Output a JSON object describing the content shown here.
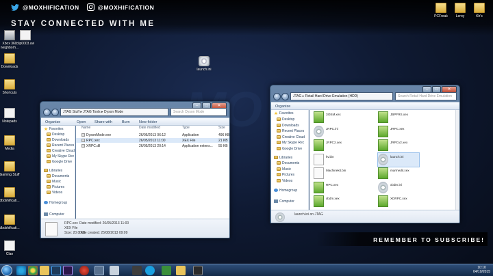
{
  "banner": {
    "twitter_handle": "@MOXHIFICATION",
    "instagram_handle": "@MOXHIFICATION",
    "stay_connected": "STAY CONNECTED WITH ME",
    "remember": "REMEMBER TO SUBSCRIBE!"
  },
  "desktop_icons_left": [
    {
      "label": "Xbox 360 neighborh...",
      "kind": "exe"
    },
    {
      "label": "clip0003.avi",
      "kind": "file"
    },
    {
      "label": "Downloads",
      "kind": "folder"
    },
    {
      "label": "Shortcuts",
      "kind": "folder"
    },
    {
      "label": "Notepads",
      "kind": "file"
    },
    {
      "label": "Media",
      "kind": "folder"
    },
    {
      "label": "Gaming Stuff",
      "kind": "folder"
    },
    {
      "label": "dbdshificati...",
      "kind": "folder"
    },
    {
      "label": "dbdshificati...",
      "kind": "folder"
    },
    {
      "label": "Clan",
      "kind": "file"
    }
  ],
  "desktop_icons_right": [
    {
      "label": "PCFreak",
      "kind": "folder"
    },
    {
      "label": "Leroy",
      "kind": "folder"
    },
    {
      "label": "Kh's",
      "kind": "folder"
    }
  ],
  "desktop_launch_ini": "launch.ini",
  "taskbar": {
    "time": "10:10",
    "date": "04/10/2015"
  },
  "win_left": {
    "address": [
      "JTAG Stuff",
      "JTAG Tools",
      "Dyson Mode"
    ],
    "search_placeholder": "Search Dyson Mode",
    "commands": [
      "Organize",
      "Open",
      "Share with",
      "Burn",
      "New folder"
    ],
    "favorites_header": "Favorites",
    "favorites": [
      "Desktop",
      "Downloads",
      "Recent Places",
      "Creative Cloud",
      "My Skype Rec",
      "Google Drive"
    ],
    "libraries_header": "Libraries",
    "libraries": [
      "Documents",
      "Music",
      "Pictures",
      "Videos"
    ],
    "homegroup": "Homegroup",
    "computer": "Computer",
    "columns": [
      "Name",
      "Date modified",
      "Type",
      "Size"
    ],
    "files": [
      {
        "name": "DysonMode.exe",
        "date": "26/05/2013 06:12",
        "type": "Application",
        "size": "496 KB"
      },
      {
        "name": "RPC.xex",
        "date": "26/05/2013 11:00",
        "type": "XEX File",
        "size": "21 KB"
      },
      {
        "name": "XRPC.dll",
        "date": "26/05/2013 20:14",
        "type": "Application extens...",
        "size": "55 KB"
      }
    ],
    "detail": {
      "name": "RPC.xex",
      "modified_label": "Date modified:",
      "modified": "26/05/2013 11:00",
      "type": "XEX File",
      "size_label": "Size:",
      "size": "20.0 KB",
      "created_label": "Date created:",
      "created": "25/08/2013 09:09"
    }
  },
  "win_right": {
    "address": [
      "JTAG",
      "Retail Hard Drive Emulation (HDD)"
    ],
    "search_placeholder": "Search Retail Hard Drive Emulation",
    "commands": [
      "Organize"
    ],
    "favorites_header": "Favorites",
    "favorites": [
      "Desktop",
      "Downloads",
      "Recent Places",
      "Creative Cloud",
      "My Skype Rec",
      "Google Drive"
    ],
    "libraries_header": "Libraries",
    "libraries": [
      "Documents",
      "Music",
      "Pictures",
      "Videos"
    ],
    "homegroup": "Homegroup",
    "computer": "Computer",
    "tiles_left": [
      {
        "name": "3I0SM.xex",
        "kind": "green"
      },
      {
        "name": "JRPC.ini",
        "kind": "gear"
      },
      {
        "name": "JRPC2.xex",
        "kind": "green"
      },
      {
        "name": "kv.bin",
        "kind": "doc"
      },
      {
        "name": "Machinekit.bin",
        "kind": "doc"
      },
      {
        "name": "RPC.xex",
        "kind": "green"
      },
      {
        "name": "xbdm.xex",
        "kind": "green"
      }
    ],
    "tiles_right": [
      {
        "name": "JBPFRS.xex",
        "kind": "green"
      },
      {
        "name": "JRPC.xex",
        "kind": "green"
      },
      {
        "name": "JRPCv2.xex",
        "kind": "green"
      },
      {
        "name": "launch.ini",
        "kind": "gear"
      },
      {
        "name": "marmedit.xex",
        "kind": "green"
      },
      {
        "name": "xbdm.ini",
        "kind": "gear"
      },
      {
        "name": "XDRPC.xex",
        "kind": "green"
      }
    ],
    "status": "launch.ini on JTAG"
  }
}
